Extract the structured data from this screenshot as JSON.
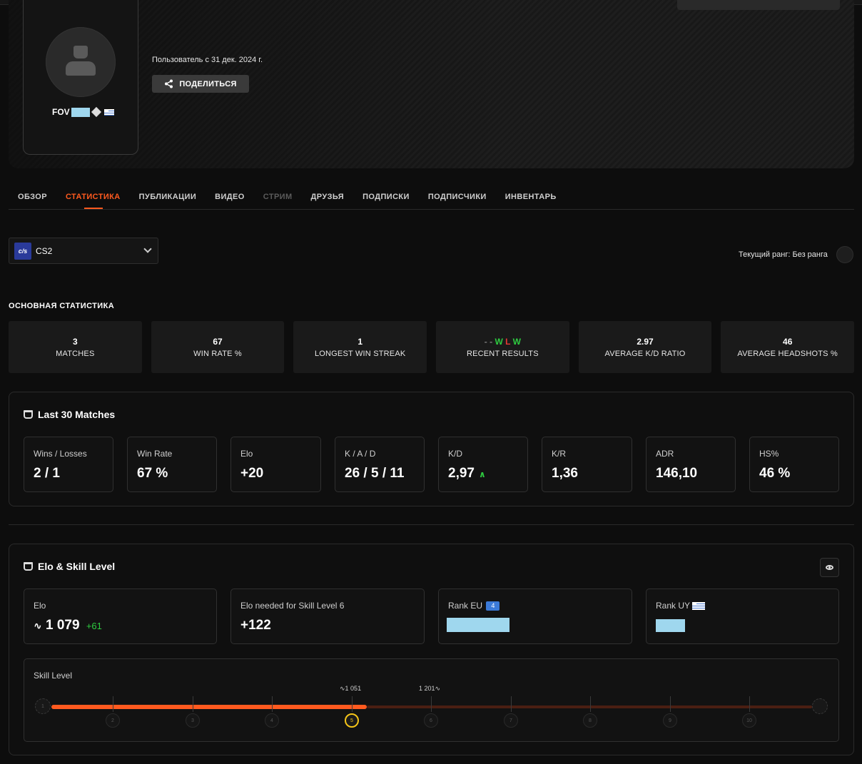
{
  "profile": {
    "nickname_prefix": "FOV",
    "member_since": "Пользователь с 31 дек. 2024 г.",
    "share_label": "ПОДЕЛИТЬСЯ"
  },
  "tabs": [
    {
      "label": "ОБЗОР",
      "state": "normal"
    },
    {
      "label": "СТАТИСТИКА",
      "state": "active"
    },
    {
      "label": "ПУБЛИКАЦИИ",
      "state": "normal"
    },
    {
      "label": "ВИДЕО",
      "state": "normal"
    },
    {
      "label": "СТРИМ",
      "state": "disabled"
    },
    {
      "label": "ДРУЗЬЯ",
      "state": "normal"
    },
    {
      "label": "ПОДПИСКИ",
      "state": "normal"
    },
    {
      "label": "ПОДПИСЧИКИ",
      "state": "normal"
    },
    {
      "label": "ИНВЕНТАРЬ",
      "state": "normal"
    }
  ],
  "game_select": {
    "logo": "c/s",
    "value": "CS2"
  },
  "current_rank": "Текущий ранг: Без ранга",
  "main_stats": {
    "title": "ОСНОВНАЯ СТАТИСТИКА",
    "items": [
      {
        "value": "3",
        "label": "MATCHES"
      },
      {
        "value": "67",
        "label": "WIN RATE %"
      },
      {
        "value": "1",
        "label": "LONGEST WIN STREAK"
      },
      {
        "value": "",
        "label": "RECENT RESULTS"
      },
      {
        "value": "2.97",
        "label": "AVERAGE K/D RATIO"
      },
      {
        "value": "46",
        "label": "AVERAGE HEADSHOTS %"
      }
    ],
    "recent_results": [
      "-",
      "-",
      "W",
      "L",
      "W"
    ]
  },
  "last30": {
    "title": "Last 30 Matches",
    "cards": [
      {
        "label": "Wins / Losses",
        "value": "2 / 1"
      },
      {
        "label": "Win Rate",
        "value": "67 %"
      },
      {
        "label": "Elo",
        "value": "+20"
      },
      {
        "label": "K / A / D",
        "value": "26 / 5 / 11"
      },
      {
        "label": "K/D",
        "value": "2,97"
      },
      {
        "label": "K/R",
        "value": "1,36"
      },
      {
        "label": "ADR",
        "value": "146,10"
      },
      {
        "label": "HS%",
        "value": "46 %"
      }
    ]
  },
  "elo_panel": {
    "title": "Elo & Skill Level",
    "elo_label": "Elo",
    "elo_value": "1 079",
    "elo_gain": "+61",
    "needed_label": "Elo needed for Skill Level 6",
    "needed_value": "+122",
    "rank_eu_label": "Rank EU",
    "rank_eu_badge": "4",
    "rank_uy_label": "Rank UY",
    "skill_label": "Skill Level",
    "marker_low": "1 051",
    "marker_high": "1 201",
    "levels": [
      "1",
      "2",
      "3",
      "4",
      "5",
      "6",
      "7",
      "8",
      "9",
      "10"
    ],
    "current_level": 5,
    "progress_fraction": 0.4
  },
  "colors": {
    "accent": "#ff5a1f",
    "win": "#2ecc40",
    "loss": "#e53935",
    "level_current": "#f5c518"
  }
}
